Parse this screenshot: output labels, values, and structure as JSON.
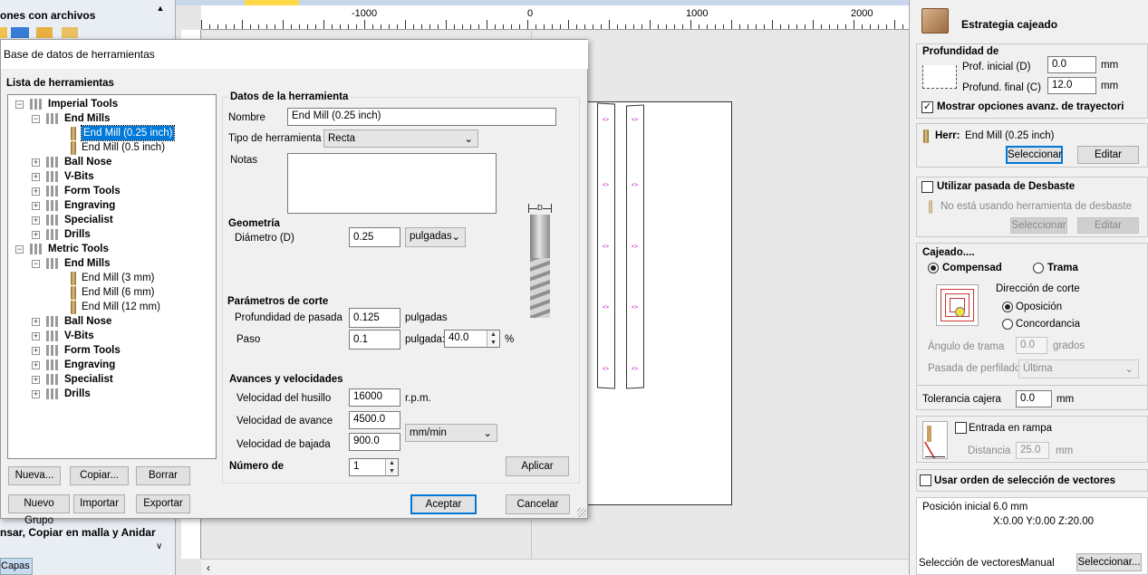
{
  "left_panel": {
    "title": "ones con archivos",
    "bottom_title": "nsar, Copiar en malla y Anidar",
    "tab": "Capas"
  },
  "ruler": {
    "labels": [
      "-1000",
      "0",
      "1000",
      "2000"
    ]
  },
  "dialog": {
    "title": "Base de datos de herramientas",
    "list_label": "Lista de herramientas",
    "tree": [
      {
        "label": "Imperial Tools",
        "level": 0,
        "kind": "group",
        "bold": true,
        "exp": "-"
      },
      {
        "label": "End Mills",
        "level": 1,
        "kind": "group",
        "bold": true,
        "exp": "-"
      },
      {
        "label": "End Mill (0.25 inch)",
        "level": 2,
        "kind": "tool",
        "selected": true
      },
      {
        "label": "End Mill (0.5 inch)",
        "level": 2,
        "kind": "tool"
      },
      {
        "label": "Ball Nose",
        "level": 1,
        "kind": "group",
        "bold": true,
        "exp": "+"
      },
      {
        "label": "V-Bits",
        "level": 1,
        "kind": "group",
        "bold": true,
        "exp": "+"
      },
      {
        "label": "Form Tools",
        "level": 1,
        "kind": "group",
        "bold": true,
        "exp": "+"
      },
      {
        "label": "Engraving",
        "level": 1,
        "kind": "group",
        "bold": true,
        "exp": "+"
      },
      {
        "label": "Specialist",
        "level": 1,
        "kind": "group",
        "bold": true,
        "exp": "+"
      },
      {
        "label": "Drills",
        "level": 1,
        "kind": "group",
        "bold": true,
        "exp": "+"
      },
      {
        "label": "Metric Tools",
        "level": 0,
        "kind": "group",
        "bold": true,
        "exp": "-"
      },
      {
        "label": "End Mills",
        "level": 1,
        "kind": "group",
        "bold": true,
        "exp": "-"
      },
      {
        "label": "End Mill (3 mm)",
        "level": 2,
        "kind": "tool"
      },
      {
        "label": "End Mill (6 mm)",
        "level": 2,
        "kind": "tool"
      },
      {
        "label": "End Mill (12 mm)",
        "level": 2,
        "kind": "tool"
      },
      {
        "label": "Ball Nose",
        "level": 1,
        "kind": "group",
        "bold": true,
        "exp": "+"
      },
      {
        "label": "V-Bits",
        "level": 1,
        "kind": "group",
        "bold": true,
        "exp": "+"
      },
      {
        "label": "Form Tools",
        "level": 1,
        "kind": "group",
        "bold": true,
        "exp": "+"
      },
      {
        "label": "Engraving",
        "level": 1,
        "kind": "group",
        "bold": true,
        "exp": "+"
      },
      {
        "label": "Specialist",
        "level": 1,
        "kind": "group",
        "bold": true,
        "exp": "+"
      },
      {
        "label": "Drills",
        "level": 1,
        "kind": "group",
        "bold": true,
        "exp": "+"
      }
    ],
    "buttons": {
      "nueva": "Nueva...",
      "copiar": "Copiar...",
      "borrar": "Borrar",
      "nuevo_grupo": "Nuevo Grupo",
      "importar": "Importar",
      "exportar": "Exportar",
      "aplicar": "Aplicar",
      "aceptar": "Aceptar",
      "cancelar": "Cancelar"
    },
    "tool_data": {
      "section": "Datos de la herramienta",
      "nombre_label": "Nombre",
      "nombre": "End Mill (0.25 inch)",
      "tipo_label": "Tipo de herramienta",
      "tipo": "Recta",
      "notas_label": "Notas",
      "geometria": "Geometría",
      "diametro_label": "Diámetro (D)",
      "diametro": "0.25",
      "diametro_unit": "pulgadas",
      "dim_letter": "D",
      "parametros": "Parámetros de corte",
      "profundidad_label": "Profundidad de pasada",
      "profundidad": "0.125",
      "profundidad_unit": "pulgadas",
      "paso_label": "Paso",
      "paso": "0.1",
      "paso_unit": "pulgada:",
      "paso_pct": "40.0",
      "pct": "%",
      "avances": "Avances y velocidades",
      "husillo_label": "Velocidad del husillo",
      "husillo": "16000",
      "husillo_unit": "r.p.m.",
      "avance_label": "Velocidad de avance",
      "avance": "4500.0",
      "bajada_label": "Velocidad de bajada",
      "bajada": "900.0",
      "feed_unit": "mm/min",
      "numero_label": "Número de",
      "numero": "1"
    }
  },
  "right_panel": {
    "title": "Estrategia cajeado",
    "profundidad": {
      "heading": "Profundidad de",
      "inicial_label": "Prof. inicial (D)",
      "inicial": "0.0",
      "final_label": "Profund. final (C)",
      "final": "12.0",
      "unit": "mm",
      "mostrar": "Mostrar opciones avanz. de trayectori"
    },
    "herr": {
      "label": "Herr:",
      "value": "End Mill (0.25 inch)",
      "seleccionar": "Seleccionar",
      "editar": "Editar"
    },
    "desbaste": {
      "label": "Utilizar pasada de Desbaste",
      "note": "No está usando herramienta de desbaste",
      "seleccionar": "Seleccionar",
      "editar": "Editar"
    },
    "cajeado": {
      "heading": "Cajeado....",
      "compensad": "Compensad",
      "trama": "Trama",
      "direccion": "Dirección de corte",
      "oposicion": "Oposición",
      "concordancia": "Concordancia",
      "angulo_label": "Ángulo de trama",
      "angulo": "0.0",
      "angulo_unit": "grados",
      "pasada_label": "Pasada de perfilado",
      "pasada": "Última"
    },
    "tolerancia": {
      "label": "Tolerancia cajera",
      "value": "0.0",
      "unit": "mm"
    },
    "rampa": {
      "label": "Entrada en rampa",
      "distancia_label": "Distancia",
      "distancia": "25.0",
      "unit": "mm"
    },
    "orden": "Usar orden de selección de vectores",
    "posicion": {
      "label": "Posición inicial",
      "value": "6.0 mm",
      "coords": "X:0.00 Y:0.00 Z:20.00"
    },
    "seleccion": {
      "label": "Selección de vectores:",
      "value": "Manual",
      "button": "Seleccionar..."
    }
  }
}
